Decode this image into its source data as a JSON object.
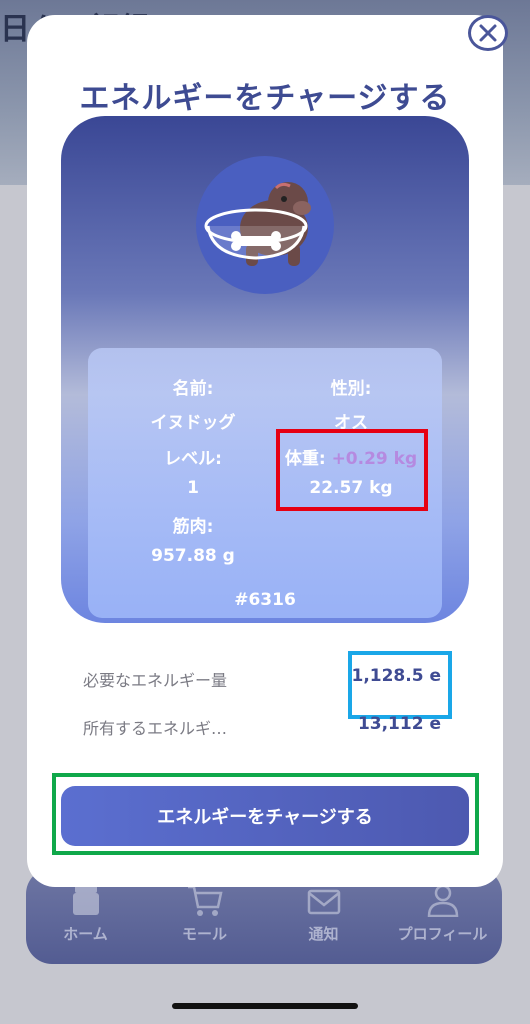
{
  "background": {
    "title_partial": "日々の記録"
  },
  "tabbar": {
    "items": [
      {
        "label": "ホーム",
        "icon": "home-icon"
      },
      {
        "label": "モール",
        "icon": "cart-icon"
      },
      {
        "label": "通知",
        "icon": "mail-icon"
      },
      {
        "label": "プロフィール",
        "icon": "user-icon"
      }
    ]
  },
  "modal": {
    "title": "エネルギーをチャージする",
    "close_icon": "close-icon",
    "pet": {
      "icon": "dog-bowl-icon",
      "name_label": "名前:",
      "name_value": "イヌドッグ",
      "gender_label": "性別:",
      "gender_value": "オス",
      "level_label": "レベル:",
      "level_value": "1",
      "weight_label": "体重:",
      "weight_delta": "+0.29 kg",
      "weight_value": "22.57 kg",
      "muscle_label": "筋肉:",
      "muscle_value": "957.88 g",
      "id": "#6316"
    },
    "required_energy_label": "必要なエネルギー量",
    "required_energy_value": "1,128.5 e",
    "owned_energy_label": "所有するエネルギ…",
    "owned_energy_value": "13,112 e",
    "charge_button_label": "エネルギーをチャージする"
  },
  "colors": {
    "accent": "#3e4b92",
    "button": "#5566c4",
    "highlight_red": "#e60012",
    "highlight_blue": "#1aa7e8",
    "highlight_green": "#0fa84a",
    "weight_delta": "#b58ae0"
  }
}
